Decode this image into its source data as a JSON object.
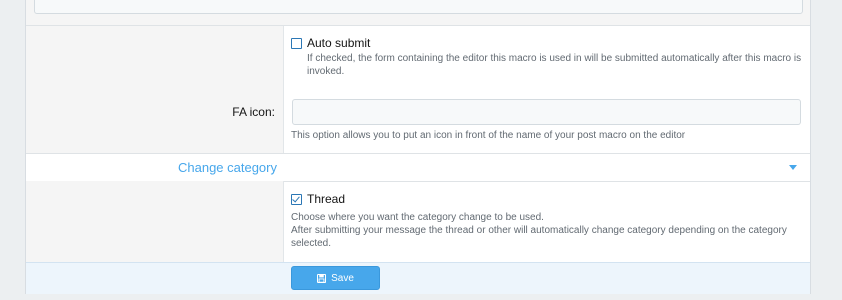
{
  "options": {
    "auto_submit": {
      "label": "Auto submit",
      "checked": false,
      "hint_line1": "If checked, the form containing the editor this macro is used in will be submitted automatically after this macro is",
      "hint_line2": "invoked."
    },
    "fa_icon": {
      "label": "FA icon:",
      "value": "",
      "hint": "This option allows you to put an icon in front of the name of your post macro on the editor"
    }
  },
  "change_category": {
    "title": "Change category",
    "thread": {
      "label": "Thread",
      "checked": true
    },
    "hint_line1": "Choose where you want the category change to be used.",
    "hint_line2": "After submitting your message the thread or other will automatically change category depending on the category",
    "hint_line3": "selected."
  },
  "footer": {
    "save_label": "Save",
    "save_icon": "floppy-disk-icon"
  },
  "colors": {
    "accent": "#47a7eb",
    "checkbox": "#2b77b5"
  }
}
